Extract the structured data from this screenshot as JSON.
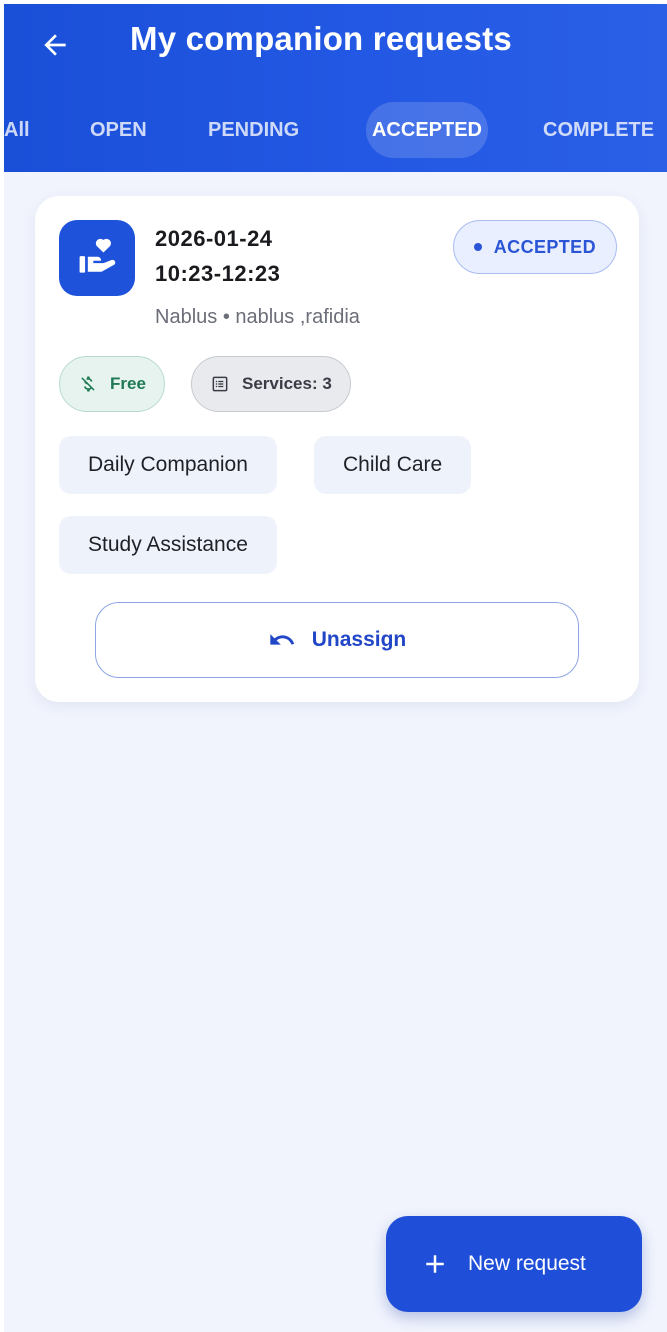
{
  "header": {
    "title": "My companion requests",
    "back_icon": "arrow-left-icon"
  },
  "tabs": [
    {
      "label": "All",
      "active": false
    },
    {
      "label": "OPEN",
      "active": false
    },
    {
      "label": "PENDING",
      "active": false
    },
    {
      "label": "ACCEPTED",
      "active": true
    },
    {
      "label": "COMPLETE",
      "active": false
    }
  ],
  "request": {
    "icon": "hand-heart-icon",
    "date": "2026-01-24",
    "time": "10:23-12:23",
    "location": "Nablus • nablus ,rafidia",
    "status": "ACCEPTED",
    "price_label": "Free",
    "price_icon": "money-off-icon",
    "services_label": "Services: 3",
    "services_icon": "list-icon",
    "services": [
      "Daily Companion",
      "Child Care",
      "Study Assistance"
    ],
    "unassign_label": "Unassign",
    "unassign_icon": "undo-icon"
  },
  "fab": {
    "label": "New request",
    "icon": "plus-icon"
  },
  "colors": {
    "primary": "#1f4fd8",
    "background": "#f1f4fd",
    "status_accent": "#2a55d6",
    "free_green": "#1e7a55"
  }
}
